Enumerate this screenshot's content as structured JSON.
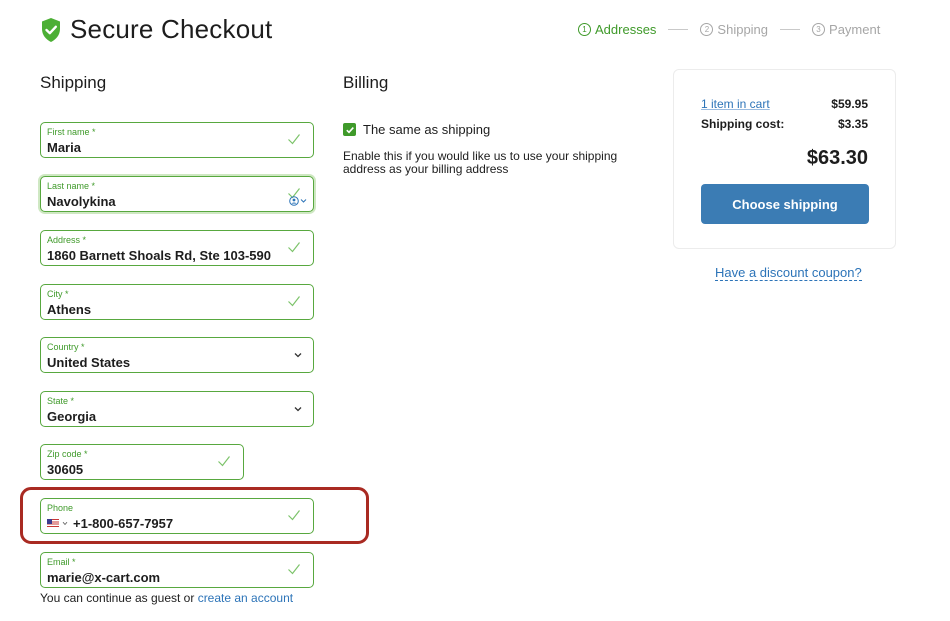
{
  "header": {
    "title": "Secure Checkout",
    "steps": [
      {
        "num": "1",
        "label": "Addresses",
        "active": true
      },
      {
        "num": "2",
        "label": "Shipping",
        "active": false
      },
      {
        "num": "3",
        "label": "Payment",
        "active": false
      }
    ]
  },
  "shipping": {
    "heading": "Shipping",
    "fields": {
      "first_name": {
        "label": "First name *",
        "value": "Maria"
      },
      "last_name": {
        "label": "Last name *",
        "value": "Navolykina"
      },
      "address": {
        "label": "Address *",
        "value": "1860 Barnett Shoals Rd, Ste 103-590"
      },
      "city": {
        "label": "City *",
        "value": "Athens"
      },
      "country": {
        "label": "Country *",
        "value": "United States"
      },
      "state": {
        "label": "State *",
        "value": "Georgia"
      },
      "zip": {
        "label": "Zip code *",
        "value": "30605"
      },
      "phone": {
        "label": "Phone",
        "value": "+1-800-657-7957"
      },
      "email": {
        "label": "Email *",
        "value": "marie@x-cart.com"
      }
    },
    "guest_text": "You can continue as guest or",
    "guest_link": "create an account"
  },
  "billing": {
    "heading": "Billing",
    "same_label": "The same as shipping",
    "same_checked": true,
    "note": "Enable this if you would like us to use your shipping address as your billing address"
  },
  "summary": {
    "items_link": "1 item in cart",
    "items_price": "$59.95",
    "shipping_label": "Shipping cost:",
    "shipping_price": "$3.35",
    "total": "$63.30",
    "button": "Choose shipping",
    "coupon": "Have a discount coupon?"
  },
  "colors": {
    "accent_green": "#3f9a2a",
    "field_border": "#58a83f",
    "primary_button": "#3b7cb4",
    "link": "#2d74b8",
    "highlight": "#a92a22"
  }
}
